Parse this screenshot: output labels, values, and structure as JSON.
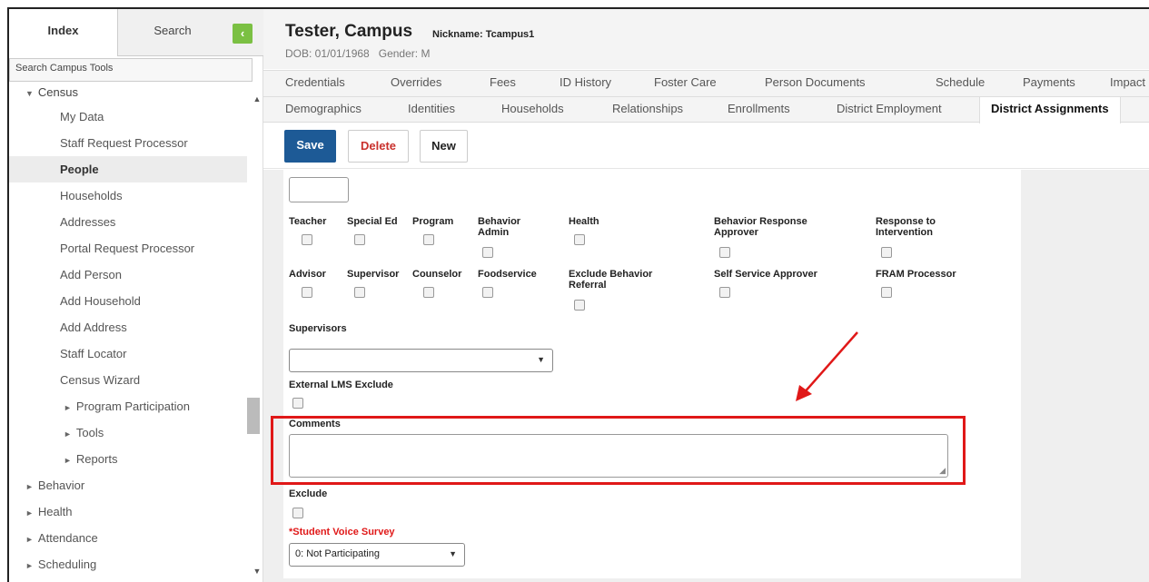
{
  "sidebar": {
    "tab_index": "Index",
    "tab_search": "Search",
    "collapse_glyph": "‹",
    "search_tools": "Search Campus Tools",
    "census_label": "Census",
    "items": [
      "My Data",
      "Staff Request Processor",
      "People",
      "Households",
      "Addresses",
      "Portal Request Processor",
      "Add Person",
      "Add Household",
      "Add Address",
      "Staff Locator",
      "Census Wizard"
    ],
    "sub_items": [
      "Program Participation",
      "Tools",
      "Reports"
    ],
    "top_items": [
      "Behavior",
      "Health",
      "Attendance",
      "Scheduling"
    ],
    "active_item": "People"
  },
  "header": {
    "name": "Tester, Campus",
    "nickname": "Nickname: Tcampus1",
    "dob": "DOB: 01/01/1968",
    "gender": "Gender: M"
  },
  "tabs_row1": [
    "Credentials",
    "Overrides",
    "Fees",
    "ID History",
    "Foster Care",
    "Person Documents",
    "Schedule",
    "Payments",
    "Impact"
  ],
  "tabs_row2": [
    "Demographics",
    "Identities",
    "Households",
    "Relationships",
    "Enrollments",
    "District Employment",
    "District Assignments"
  ],
  "actions": {
    "save": "Save",
    "delete": "Delete",
    "new": "New"
  },
  "roles_row1": [
    "Teacher",
    "Special Ed",
    "Program",
    "Behavior Admin",
    "Health",
    "Behavior Response Approver",
    "Response to Intervention"
  ],
  "roles_row2": [
    "Advisor",
    "Supervisor",
    "Counselor",
    "Foodservice",
    "Exclude Behavior Referral",
    "Self Service Approver",
    "FRAM Processor"
  ],
  "fields": {
    "supervisors_label": "Supervisors",
    "supervisors_value": "",
    "external_lms_label": "External LMS Exclude",
    "comments_label": "Comments",
    "comments_value": "",
    "exclude_label": "Exclude",
    "voice_survey_label": "Student Voice Survey",
    "voice_survey_required": "*",
    "voice_survey_value": "0: Not Participating"
  },
  "annotation": {
    "highlight_color": "#e01818"
  },
  "colors": {
    "save_button": "#1d5a96",
    "collapse_button": "#7bc043",
    "delete_text": "#c9302c"
  }
}
